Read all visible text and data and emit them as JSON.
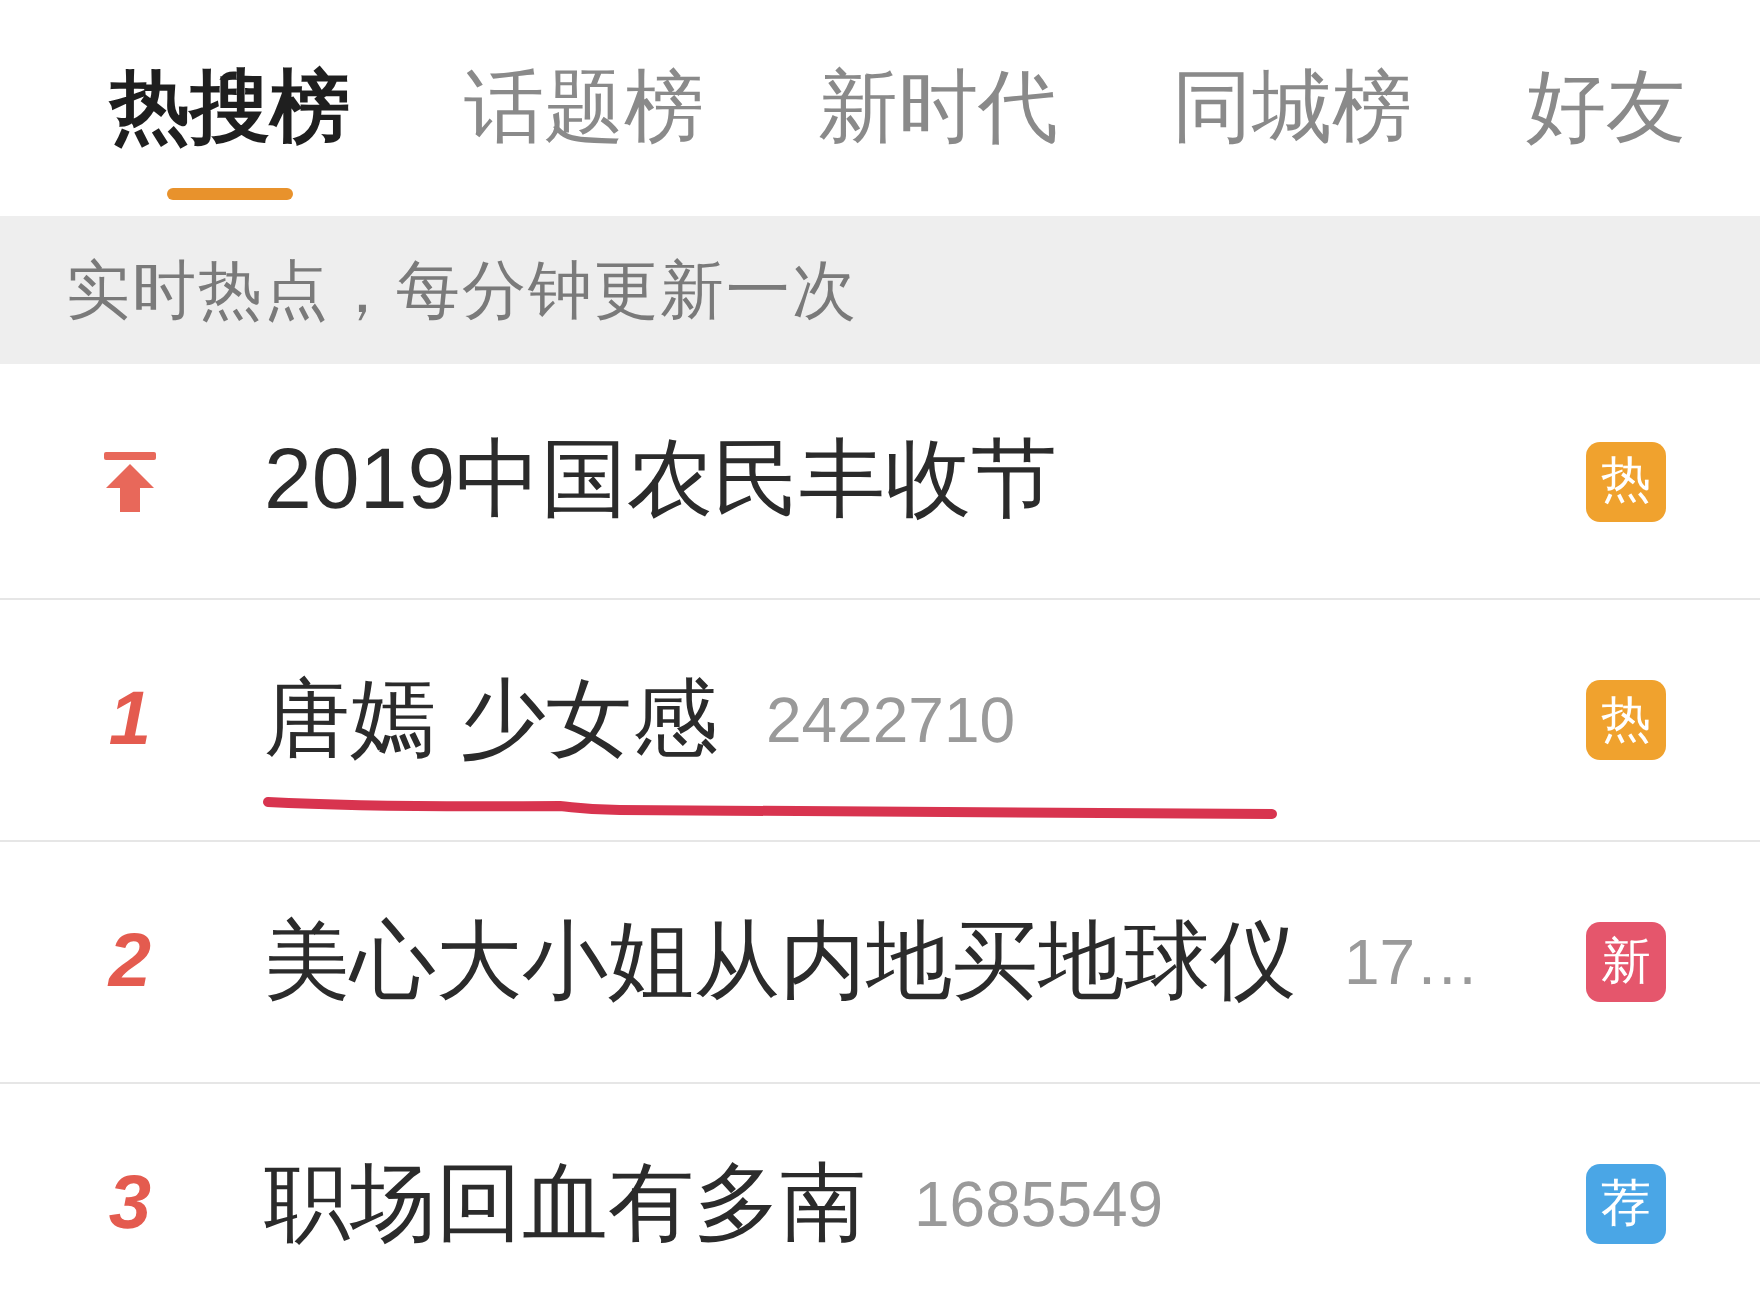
{
  "tabs": [
    {
      "label": "热搜榜",
      "selected": true
    },
    {
      "label": "话题榜",
      "selected": false
    },
    {
      "label": "新时代",
      "selected": false
    },
    {
      "label": "同城榜",
      "selected": false
    },
    {
      "label": "好友",
      "selected": false
    }
  ],
  "notice": "实时热点，每分钟更新一次",
  "rows": [
    {
      "kind": "pinned",
      "title": "2019中国农民丰收节",
      "badge": {
        "text": "热",
        "color": "#f0a22e"
      },
      "underlined": false
    },
    {
      "kind": "ranked",
      "rank": "1",
      "title": "唐嫣 少女感",
      "count": "2422710",
      "badge": {
        "text": "热",
        "color": "#f0a22e"
      },
      "underlined": true
    },
    {
      "kind": "ranked",
      "rank": "2",
      "title": "美心大小姐从内地买地球仪",
      "count": "17…",
      "badge": {
        "text": "新",
        "color": "#e5566c"
      },
      "underlined": false
    },
    {
      "kind": "ranked",
      "rank": "3",
      "title": "职场回血有多南",
      "count": "1685549",
      "badge": {
        "text": "荐",
        "color": "#4aa6e6"
      },
      "underlined": false
    }
  ]
}
